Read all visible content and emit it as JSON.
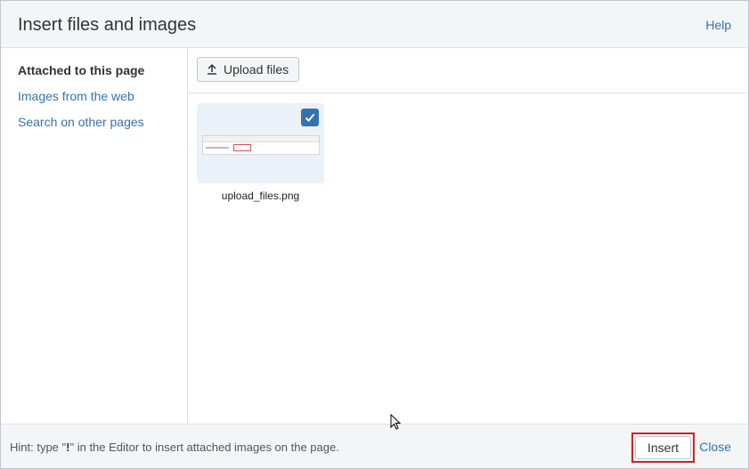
{
  "dialog": {
    "title": "Insert files and images",
    "help_label": "Help"
  },
  "sidebar": {
    "items": [
      {
        "label": "Attached to this page",
        "active": true
      },
      {
        "label": "Images from the web",
        "active": false
      },
      {
        "label": "Search on other pages",
        "active": false
      }
    ]
  },
  "toolbar": {
    "upload_label": "Upload files",
    "upload_icon": "upload-icon"
  },
  "files": [
    {
      "name": "upload_files.png",
      "selected": true
    }
  ],
  "footer": {
    "hint_prefix": "Hint: type \"",
    "hint_key": "!",
    "hint_suffix": "\" in the Editor to insert attached images on the page.",
    "insert_label": "Insert",
    "close_label": "Close"
  },
  "colors": {
    "link": "#3572b0",
    "header_bg": "#f4f5f7",
    "tile_bg": "#ebf1f9",
    "highlight_border": "#cc2222"
  }
}
